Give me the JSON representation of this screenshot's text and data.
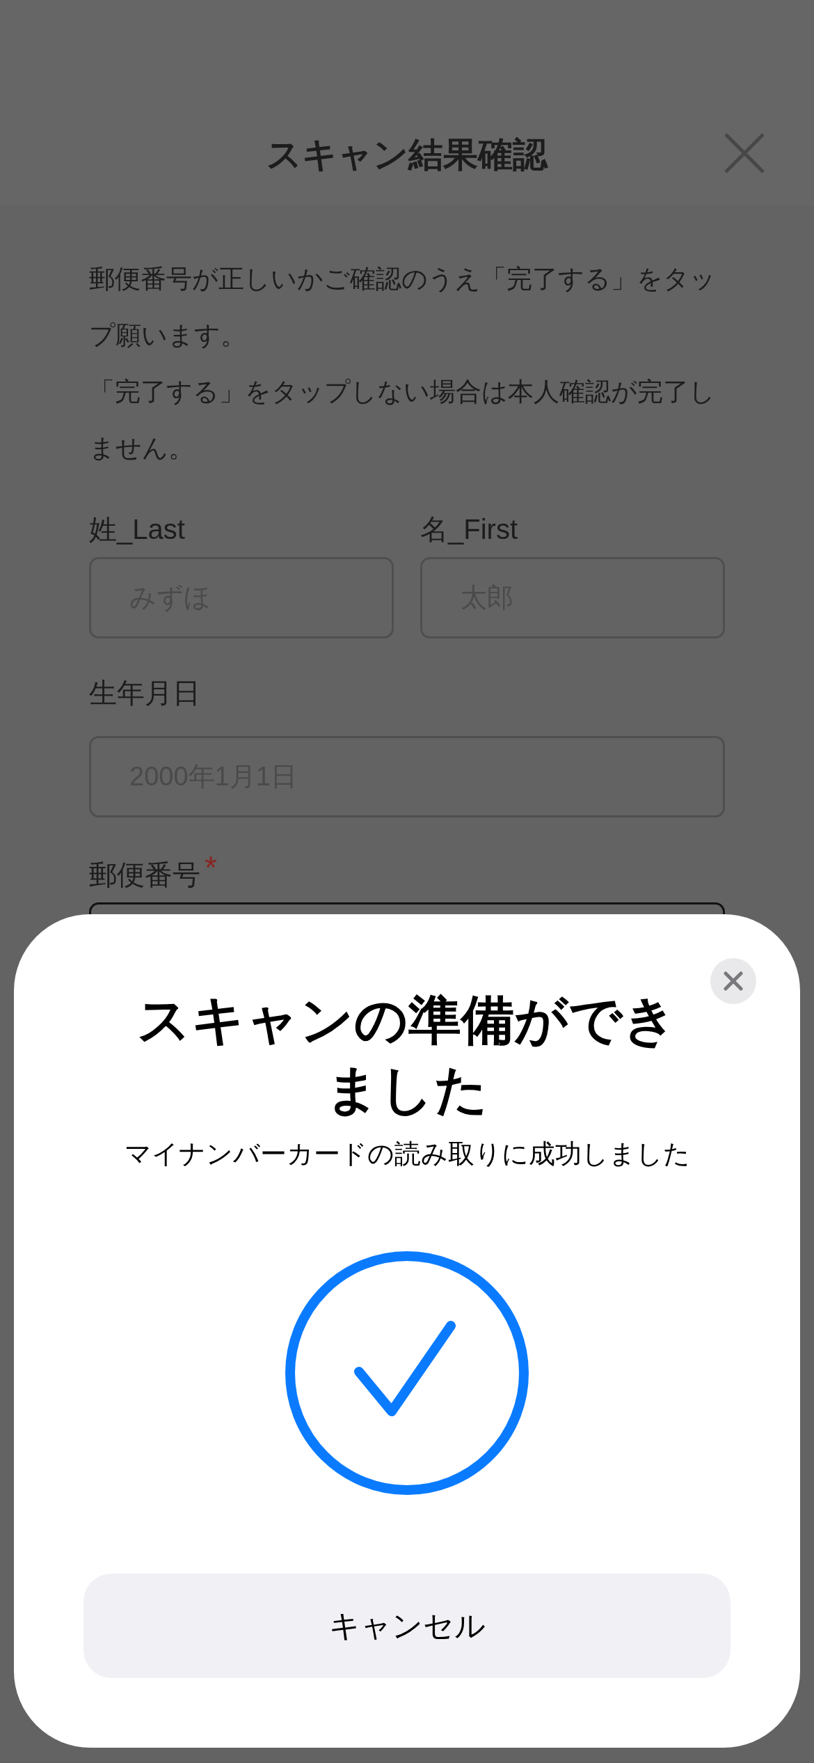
{
  "header": {
    "title": "スキャン結果確認"
  },
  "intro": [
    "郵便番号が正しいかご確認のうえ「完了する」をタップ願います。",
    "「完了する」をタップしない場合は本人確認が完了しません。"
  ],
  "form": {
    "name_fields": [
      {
        "label": "姓_Last",
        "placeholder": "みずほ"
      },
      {
        "label": "名_First",
        "placeholder": "太郎"
      }
    ],
    "birthdate": {
      "label": "生年月日",
      "placeholder": "2000年1月1日"
    },
    "postal_code": {
      "label": "郵便番号",
      "required_mark": "*"
    }
  },
  "sheet": {
    "title": "スキャンの準備ができました",
    "subtitle": "マイナンバーカードの読み取りに成功しました",
    "scan_succeeded": true,
    "cancel_button": "キャンセル"
  }
}
